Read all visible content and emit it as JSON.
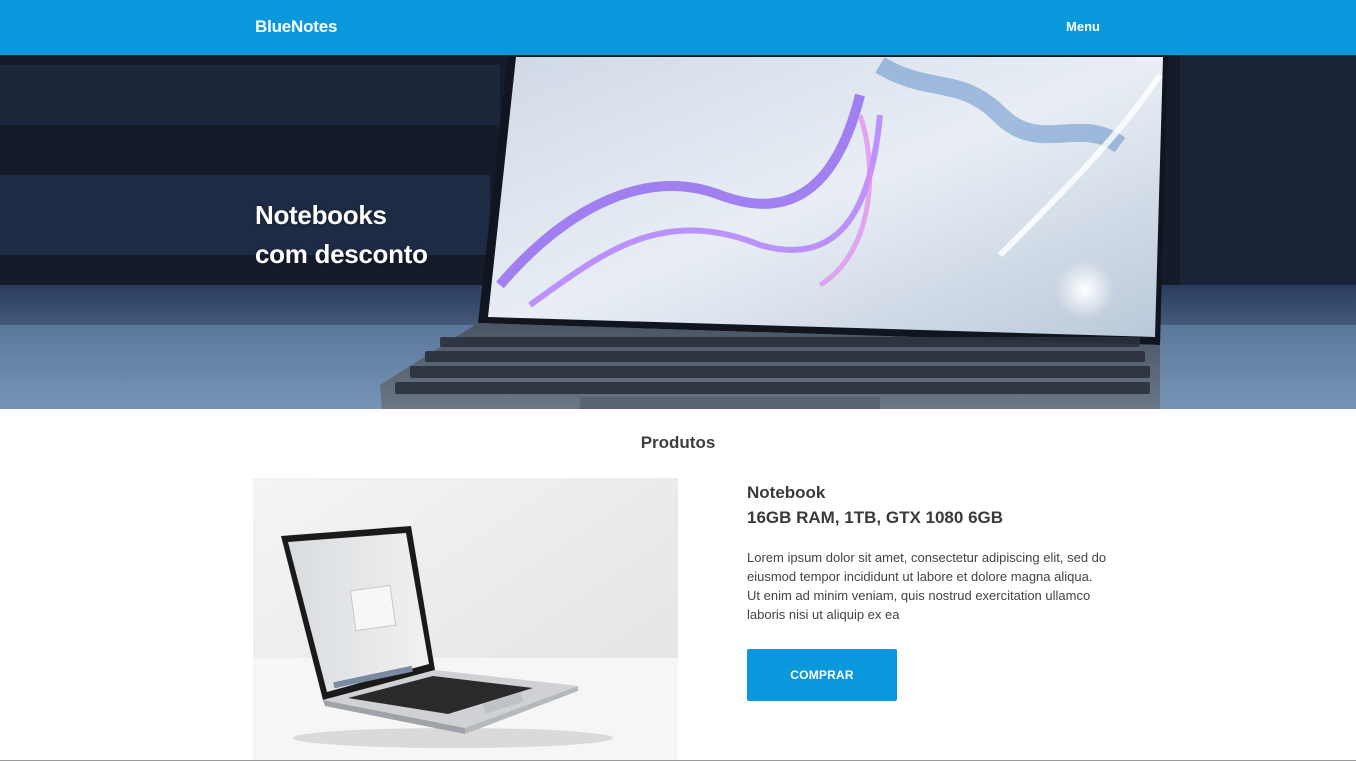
{
  "header": {
    "brand": "BlueNotes",
    "menu_label": "Menu",
    "background_color": "#0a98dc"
  },
  "hero": {
    "title_line1": "Notebooks",
    "title_line2": "com desconto",
    "image": "laptop-with-marble-wallpaper-photo"
  },
  "products_section": {
    "title": "Produtos"
  },
  "product": {
    "image": "laptop-on-white-desk-photo",
    "name_line1": "Notebook",
    "name_line2": "16GB RAM, 1TB, GTX 1080 6GB",
    "description": "Lorem ipsum dolor sit amet, consectetur adipiscing elit, sed do eiusmod tempor incididunt ut labore et dolore magna aliqua. Ut enim ad minim veniam, quis nostrud exercitation ullamco laboris nisi ut aliquip ex ea",
    "buy_label": "COMPRAR",
    "button_color": "#0a98dc"
  }
}
